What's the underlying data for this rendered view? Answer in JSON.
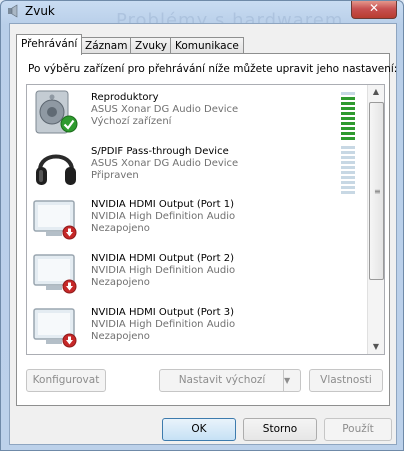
{
  "window": {
    "title": "Zvuk",
    "close_label": "✕",
    "background_title": "Problémy s hardwarem"
  },
  "tabs": [
    {
      "label": "Přehrávání",
      "active": true
    },
    {
      "label": "Záznam",
      "active": false
    },
    {
      "label": "Zvuky",
      "active": false
    },
    {
      "label": "Komunikace",
      "active": false
    }
  ],
  "playback": {
    "instruction": "Po výběru zařízení pro přehrávání níže můžete upravit jeho nastavení:",
    "devices": [
      {
        "name": "Reproduktory",
        "driver": "ASUS Xonar DG Audio Device",
        "status": "Výchozí zařízení",
        "icon": "speaker-icon",
        "badge": "default-check-icon",
        "level": 0.9
      },
      {
        "name": "S/PDIF Pass-through Device",
        "driver": "ASUS Xonar DG Audio Device",
        "status": "Připraven",
        "icon": "headphones-icon",
        "badge": "",
        "level": 0
      },
      {
        "name": "NVIDIA HDMI Output (Port 1)",
        "driver": "NVIDIA High Definition Audio",
        "status": "Nezapojeno",
        "icon": "monitor-icon",
        "badge": "unplugged-icon",
        "level": null
      },
      {
        "name": "NVIDIA HDMI Output (Port 2)",
        "driver": "NVIDIA High Definition Audio",
        "status": "Nezapojeno",
        "icon": "monitor-icon",
        "badge": "unplugged-icon",
        "level": null
      },
      {
        "name": "NVIDIA HDMI Output (Port 3)",
        "driver": "NVIDIA High Definition Audio",
        "status": "Nezapojeno",
        "icon": "monitor-icon",
        "badge": "unplugged-icon",
        "level": null
      }
    ]
  },
  "actions": {
    "configure": "Konfigurovat",
    "set_default": "Nastavit výchozí",
    "properties": "Vlastnosti"
  },
  "footer": {
    "ok": "OK",
    "cancel": "Storno",
    "apply": "Použít"
  },
  "colors": {
    "level_active": "#2e9a2e",
    "level_inactive": "#c8d8e4"
  }
}
